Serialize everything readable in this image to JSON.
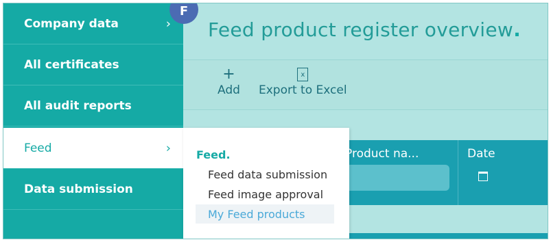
{
  "sidebar": {
    "items": [
      {
        "label": "Company data",
        "chevron": "›"
      },
      {
        "label": "All certificates"
      },
      {
        "label": "All audit reports"
      },
      {
        "label": "Feed",
        "chevron": "›",
        "active": true
      },
      {
        "label": "Data submission"
      }
    ]
  },
  "avatar": {
    "initial": "F"
  },
  "page": {
    "title": "Feed product register overview",
    "title_dot": "."
  },
  "toolbar": {
    "add_label": "Add",
    "add_icon": "plus-icon",
    "export_label": "Export to Excel",
    "export_icon": "excel-file-icon"
  },
  "table": {
    "columns": [
      {
        "label": "Product na..."
      },
      {
        "label": "Date"
      }
    ]
  },
  "flyout": {
    "title": "Feed",
    "title_dot": ".",
    "items": [
      {
        "label": "Feed data submission"
      },
      {
        "label": "Feed image approval"
      },
      {
        "label": "My Feed products",
        "selected": true
      }
    ]
  },
  "colors": {
    "sidebar_bg": "#15aaa5",
    "accent": "#15aaa5",
    "table_header": "#1a9fb0",
    "selected_item": "#4aa9d8"
  }
}
